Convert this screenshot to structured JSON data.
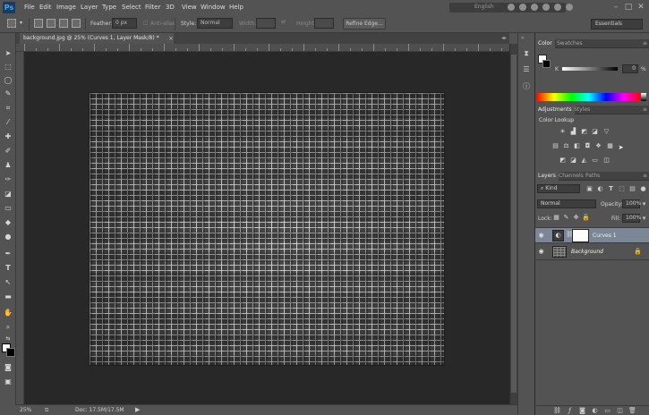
{
  "app": {
    "logo": "Ps"
  },
  "menu": [
    "File",
    "Edit",
    "Image",
    "Layer",
    "Type",
    "Select",
    "Filter",
    "3D",
    "View",
    "Window",
    "Help"
  ],
  "menubar_right": {
    "language": "English",
    "icons": [
      "globe-icon",
      "settings-icon",
      "refresh-icon",
      "info-icon",
      "help-icon",
      "user-icon"
    ]
  },
  "window_controls": {
    "minimize": "–",
    "maximize": "□",
    "close": "✕"
  },
  "options": {
    "feather_label": "Feather:",
    "feather_value": "0 px",
    "antialias_label": "Anti-alias",
    "style_label": "Style:",
    "style_value": "Normal",
    "width_label": "Width:",
    "height_label": "Height:",
    "refine_edge": "Refine Edge...",
    "workspace": "Essentials"
  },
  "document": {
    "tab_title": "background.jpg @ 25% (Curves 1, Layer Mask/8) *",
    "tab_close": "×",
    "zoom": "25%",
    "doc_size": "Doc: 17.5M/17.5M",
    "status_arrow": "▶"
  },
  "color_panel": {
    "tabs": [
      "Color",
      "Swatches"
    ],
    "channel_label": "K",
    "channel_value": "0",
    "unit": "%"
  },
  "adjustments_panel": {
    "tabs": [
      "Adjustments",
      "Styles"
    ],
    "hover_label": "Color Lookup"
  },
  "layers_panel": {
    "tabs": [
      "Layers",
      "Channels",
      "Paths"
    ],
    "filter_kind": "Kind",
    "blend_mode": "Normal",
    "opacity_label": "Opacity:",
    "opacity_value": "100%",
    "lock_label": "Lock:",
    "fill_label": "Fill:",
    "fill_value": "100%",
    "layers": [
      {
        "name": "Curves 1",
        "selected": true
      },
      {
        "name": "Background",
        "selected": false
      }
    ]
  },
  "colors": {
    "chrome": "#535353",
    "canvas_bg": "#282828",
    "selected_layer": "#7b8797",
    "ps_blue": "#3fa9f5"
  }
}
